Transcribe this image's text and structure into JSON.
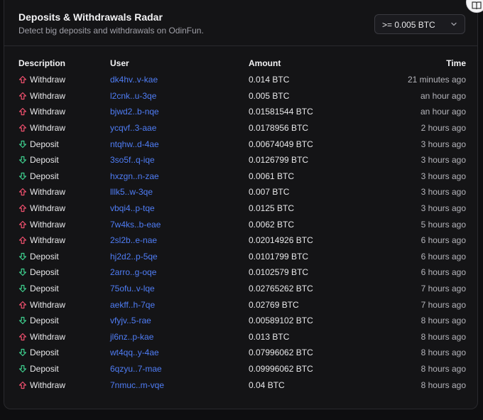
{
  "header": {
    "title": "Deposits & Withdrawals Radar",
    "subtitle": "Detect big deposits and withdrawals on OdinFun.",
    "threshold": ">= 0.005 BTC"
  },
  "colors": {
    "withdraw": "#f0506e",
    "deposit": "#3ecf8e",
    "link": "#4f7df5"
  },
  "table": {
    "columns": [
      "Description",
      "User",
      "Amount",
      "Time"
    ],
    "rows": [
      {
        "type": "withdraw",
        "description": "Withdraw",
        "user": "dk4hv..v-kae",
        "amount": "0.014 BTC",
        "time": "21 minutes ago"
      },
      {
        "type": "withdraw",
        "description": "Withdraw",
        "user": "l2cnk..u-3qe",
        "amount": "0.005 BTC",
        "time": "an hour ago"
      },
      {
        "type": "withdraw",
        "description": "Withdraw",
        "user": "bjwd2..b-nqe",
        "amount": "0.01581544 BTC",
        "time": "an hour ago"
      },
      {
        "type": "withdraw",
        "description": "Withdraw",
        "user": "ycqvf..3-aae",
        "amount": "0.0178956 BTC",
        "time": "2 hours ago"
      },
      {
        "type": "deposit",
        "description": "Deposit",
        "user": "ntqhw..d-4ae",
        "amount": "0.00674049 BTC",
        "time": "3 hours ago"
      },
      {
        "type": "deposit",
        "description": "Deposit",
        "user": "3so5f..q-iqe",
        "amount": "0.0126799 BTC",
        "time": "3 hours ago"
      },
      {
        "type": "deposit",
        "description": "Deposit",
        "user": "hxzgn..n-zae",
        "amount": "0.0061 BTC",
        "time": "3 hours ago"
      },
      {
        "type": "withdraw",
        "description": "Withdraw",
        "user": "lllk5..w-3qe",
        "amount": "0.007 BTC",
        "time": "3 hours ago"
      },
      {
        "type": "withdraw",
        "description": "Withdraw",
        "user": "vbqi4..p-tqe",
        "amount": "0.0125 BTC",
        "time": "3 hours ago"
      },
      {
        "type": "withdraw",
        "description": "Withdraw",
        "user": "7w4ks..b-eae",
        "amount": "0.0062 BTC",
        "time": "5 hours ago"
      },
      {
        "type": "withdraw",
        "description": "Withdraw",
        "user": "2sl2b..e-nae",
        "amount": "0.02014926 BTC",
        "time": "6 hours ago"
      },
      {
        "type": "deposit",
        "description": "Deposit",
        "user": "hj2d2..p-5qe",
        "amount": "0.0101799 BTC",
        "time": "6 hours ago"
      },
      {
        "type": "deposit",
        "description": "Deposit",
        "user": "2arro..g-oqe",
        "amount": "0.0102579 BTC",
        "time": "6 hours ago"
      },
      {
        "type": "deposit",
        "description": "Deposit",
        "user": "75ofu..v-lqe",
        "amount": "0.02765262 BTC",
        "time": "7 hours ago"
      },
      {
        "type": "withdraw",
        "description": "Withdraw",
        "user": "aekff..h-7qe",
        "amount": "0.02769 BTC",
        "time": "7 hours ago"
      },
      {
        "type": "deposit",
        "description": "Deposit",
        "user": "vfyjv..5-rae",
        "amount": "0.00589102 BTC",
        "time": "8 hours ago"
      },
      {
        "type": "withdraw",
        "description": "Withdraw",
        "user": "jl6nz..p-kae",
        "amount": "0.013 BTC",
        "time": "8 hours ago"
      },
      {
        "type": "deposit",
        "description": "Deposit",
        "user": "wt4qq..y-4ae",
        "amount": "0.07996062 BTC",
        "time": "8 hours ago"
      },
      {
        "type": "deposit",
        "description": "Deposit",
        "user": "6qzyu..7-mae",
        "amount": "0.09996062 BTC",
        "time": "8 hours ago"
      },
      {
        "type": "withdraw",
        "description": "Withdraw",
        "user": "7nmuc..m-vqe",
        "amount": "0.04 BTC",
        "time": "8 hours ago"
      }
    ]
  }
}
